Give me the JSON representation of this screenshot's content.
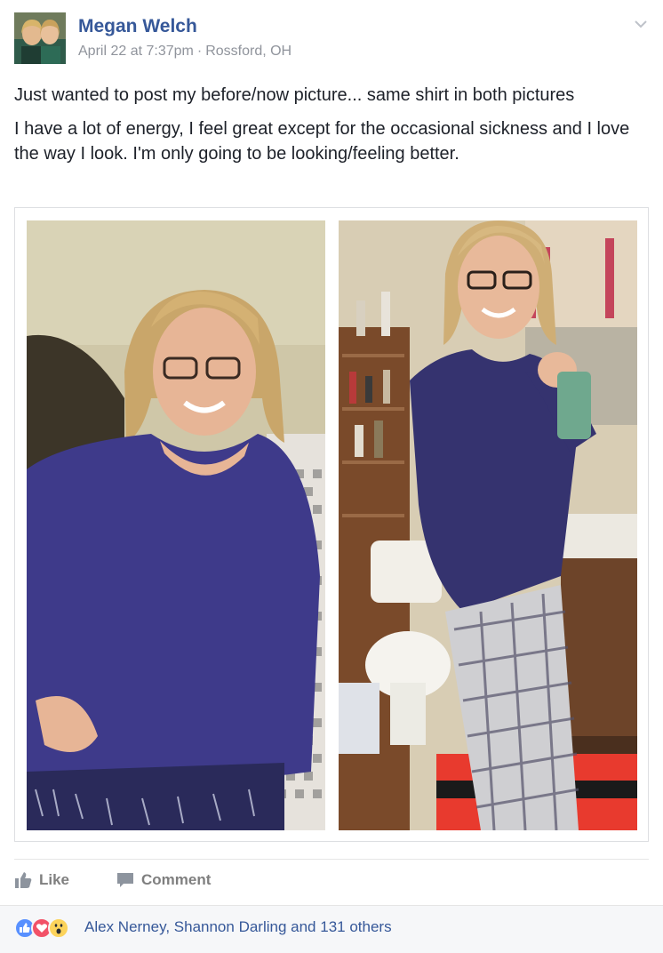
{
  "post": {
    "author": "Megan Welch",
    "timestamp": "April 22 at 7:37pm",
    "location": "Rossford, OH",
    "separator": "·",
    "paragraphs": [
      "Just wanted to post my before/now picture... same shirt in both pictures",
      "I have a lot of energy, I feel great except for the occasional sickness and I love the way I look. I'm only going to be looking/feeling better."
    ],
    "photos": [
      {
        "alt": "before photo"
      },
      {
        "alt": "now photo"
      }
    ]
  },
  "actions": {
    "like_label": "Like",
    "comment_label": "Comment"
  },
  "reactions": {
    "icons": [
      "like-icon",
      "love-icon",
      "wow-icon"
    ],
    "summary": "Alex Nerney, Shannon Darling and 131 others"
  },
  "colors": {
    "link": "#365899",
    "meta": "#90949c",
    "action": "#7f7f7f",
    "like": "#5890ff",
    "love": "#f25268",
    "wow": "#fcd35b"
  }
}
